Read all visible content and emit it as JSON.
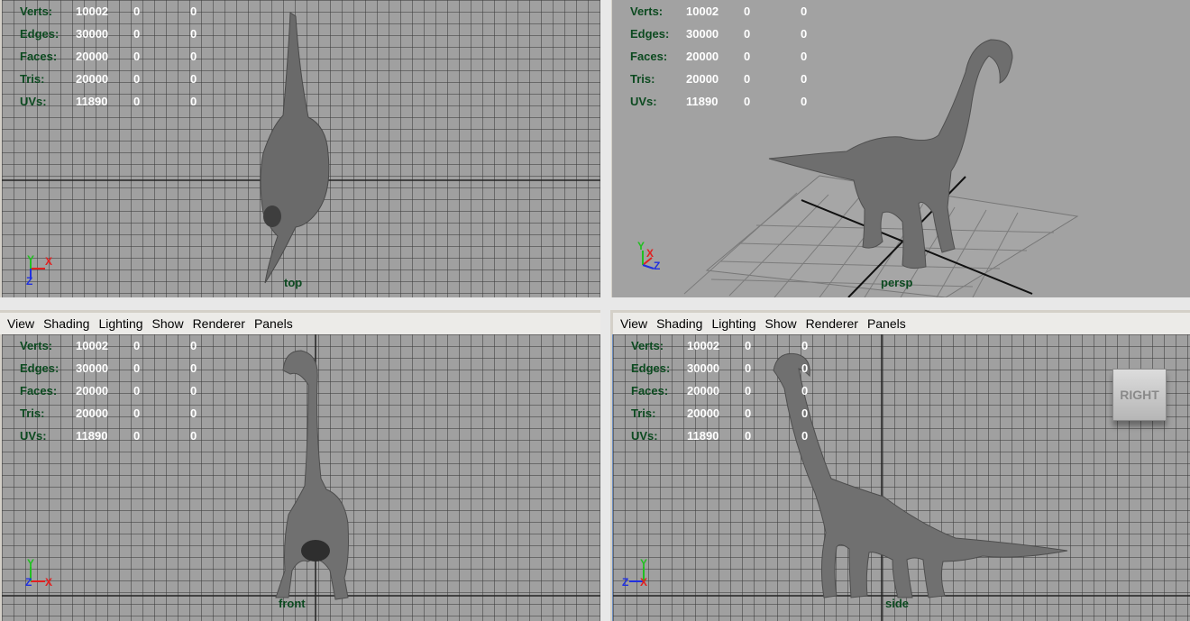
{
  "menu": {
    "view": "View",
    "shading": "Shading",
    "lighting": "Lighting",
    "show": "Show",
    "renderer": "Renderer",
    "panels": "Panels"
  },
  "hud": {
    "verts": {
      "label": "Verts:",
      "v1": "10002",
      "v2": "0",
      "v3": "0"
    },
    "edges": {
      "label": "Edges:",
      "v1": "30000",
      "v2": "0",
      "v3": "0"
    },
    "faces": {
      "label": "Faces:",
      "v1": "20000",
      "v2": "0",
      "v3": "0"
    },
    "tris": {
      "label": "Tris:",
      "v1": "20000",
      "v2": "0",
      "v3": "0"
    },
    "uvs": {
      "label": "UVs:",
      "v1": "11890",
      "v2": "0",
      "v3": "0"
    }
  },
  "cameras": {
    "top": "top",
    "persp": "persp",
    "front": "front",
    "side": "side"
  },
  "viewcube": {
    "label": "RIGHT"
  },
  "axes": {
    "x": "X",
    "y": "Y",
    "z": "Z"
  },
  "colors": {
    "hud_label": "#0c4a20",
    "axis_x": "#e02020",
    "axis_y": "#20c020",
    "axis_z": "#2030e0",
    "model": "#6e6e6e"
  }
}
